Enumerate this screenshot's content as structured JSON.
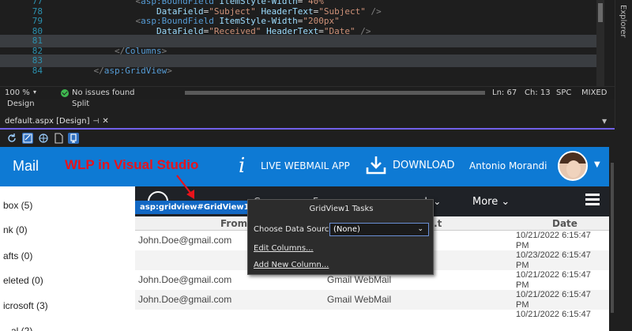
{
  "editor": {
    "lines": [
      {
        "num": "77",
        "indent": "            ",
        "html_parts": [
          [
            "tag",
            "<"
          ],
          [
            "tn",
            "asp:BoundField"
          ],
          [
            "eq",
            " "
          ],
          [
            "an",
            "ItemStyle-Width"
          ],
          [
            "eq",
            "="
          ],
          [
            "av",
            "\"40%\""
          ]
        ]
      },
      {
        "num": "78",
        "indent": "                ",
        "html_parts": [
          [
            "an",
            "DataField"
          ],
          [
            "eq",
            "="
          ],
          [
            "av",
            "\"Subject\""
          ],
          [
            "eq",
            " "
          ],
          [
            "an",
            "HeaderText"
          ],
          [
            "eq",
            "="
          ],
          [
            "av",
            "\"Subject\""
          ],
          [
            "eq",
            " "
          ],
          [
            "tag",
            "/>"
          ]
        ]
      },
      {
        "num": "79",
        "indent": "            ",
        "html_parts": [
          [
            "tag",
            "<"
          ],
          [
            "tn",
            "asp:BoundField"
          ],
          [
            "eq",
            " "
          ],
          [
            "an",
            "ItemStyle-Width"
          ],
          [
            "eq",
            "="
          ],
          [
            "av",
            "\"200px\""
          ]
        ]
      },
      {
        "num": "80",
        "indent": "                ",
        "html_parts": [
          [
            "an",
            "DataField"
          ],
          [
            "eq",
            "="
          ],
          [
            "av",
            "\"Received\""
          ],
          [
            "eq",
            " "
          ],
          [
            "an",
            "HeaderText"
          ],
          [
            "eq",
            "="
          ],
          [
            "av",
            "\"Date\""
          ],
          [
            "eq",
            " "
          ],
          [
            "tag",
            "/>"
          ]
        ]
      },
      {
        "num": "81",
        "indent": "",
        "html_parts": []
      },
      {
        "num": "82",
        "indent": "        ",
        "html_parts": [
          [
            "tag",
            "</"
          ],
          [
            "tn",
            "Columns"
          ],
          [
            "tag",
            ">"
          ]
        ]
      },
      {
        "num": "83",
        "indent": "",
        "html_parts": []
      },
      {
        "num": "84",
        "indent": "    ",
        "html_parts": [
          [
            "tag",
            "</"
          ],
          [
            "tn",
            "asp:GridView"
          ],
          [
            "tag",
            ">"
          ]
        ]
      }
    ],
    "side_panel": "Explorer"
  },
  "status": {
    "zoom": "100 %",
    "issues": "No issues found",
    "ln": "Ln: 67",
    "ch": "Ch: 13",
    "spc": "SPC",
    "eol": "MIXED"
  },
  "view_tabs": {
    "design": "Design",
    "split": "Split"
  },
  "doc_tab": {
    "title": "default.aspx [Design]",
    "pin": "⊣",
    "close": "✕"
  },
  "webmail": {
    "title": "Mail",
    "annotation": "WLP in Visual Studio",
    "info_glyph": "i",
    "live": "LIVE WEBMAIL APP",
    "download": "DOWNLOAD",
    "user": "Antonio Morandi",
    "caret": "▼",
    "nav_more": "More ⌄",
    "nav_ghost_1": "C...",
    "nav_ghost_2": "F...",
    "nav_ghost_3": "...k ⌄"
  },
  "folders": [
    "box (5)",
    "nk (0)",
    "afts (0)",
    "eleted (0)",
    "icrosoft (3)",
    "...al (2)"
  ],
  "grid": {
    "headers": {
      "from": "From",
      "subject": "...t",
      "date": "Date"
    },
    "rows": [
      {
        "from": "John.Doe@gmail.com",
        "subject": "",
        "date": "10/21/2022 6:15:47 PM"
      },
      {
        "from": "",
        "subject": "",
        "date": "10/23/2022 6:15:47 PM"
      },
      {
        "from": "John.Doe@gmail.com",
        "subject": "Gmail WebMail",
        "date": "10/21/2022 6:15:47 PM"
      },
      {
        "from": "John.Doe@gmail.com",
        "subject": "Gmail WebMail",
        "date": "10/21/2022 6:15:47 PM"
      },
      {
        "from": "",
        "subject": "",
        "date": "10/21/2022 6:15:47"
      }
    ]
  },
  "badge": {
    "label": "asp:gridview#GridView1",
    "chev": "»"
  },
  "tasks": {
    "title": "GridView1 Tasks",
    "choose_label": "Choose Data Source:",
    "choose_value": "(None)",
    "edit_columns": "Edit Columns...",
    "add_column": "Add New Column..."
  },
  "colors": {
    "accent": "#0e7ad4",
    "navbar": "#1f2227",
    "annotation": "#e8131b",
    "badge": "#1268c4"
  }
}
